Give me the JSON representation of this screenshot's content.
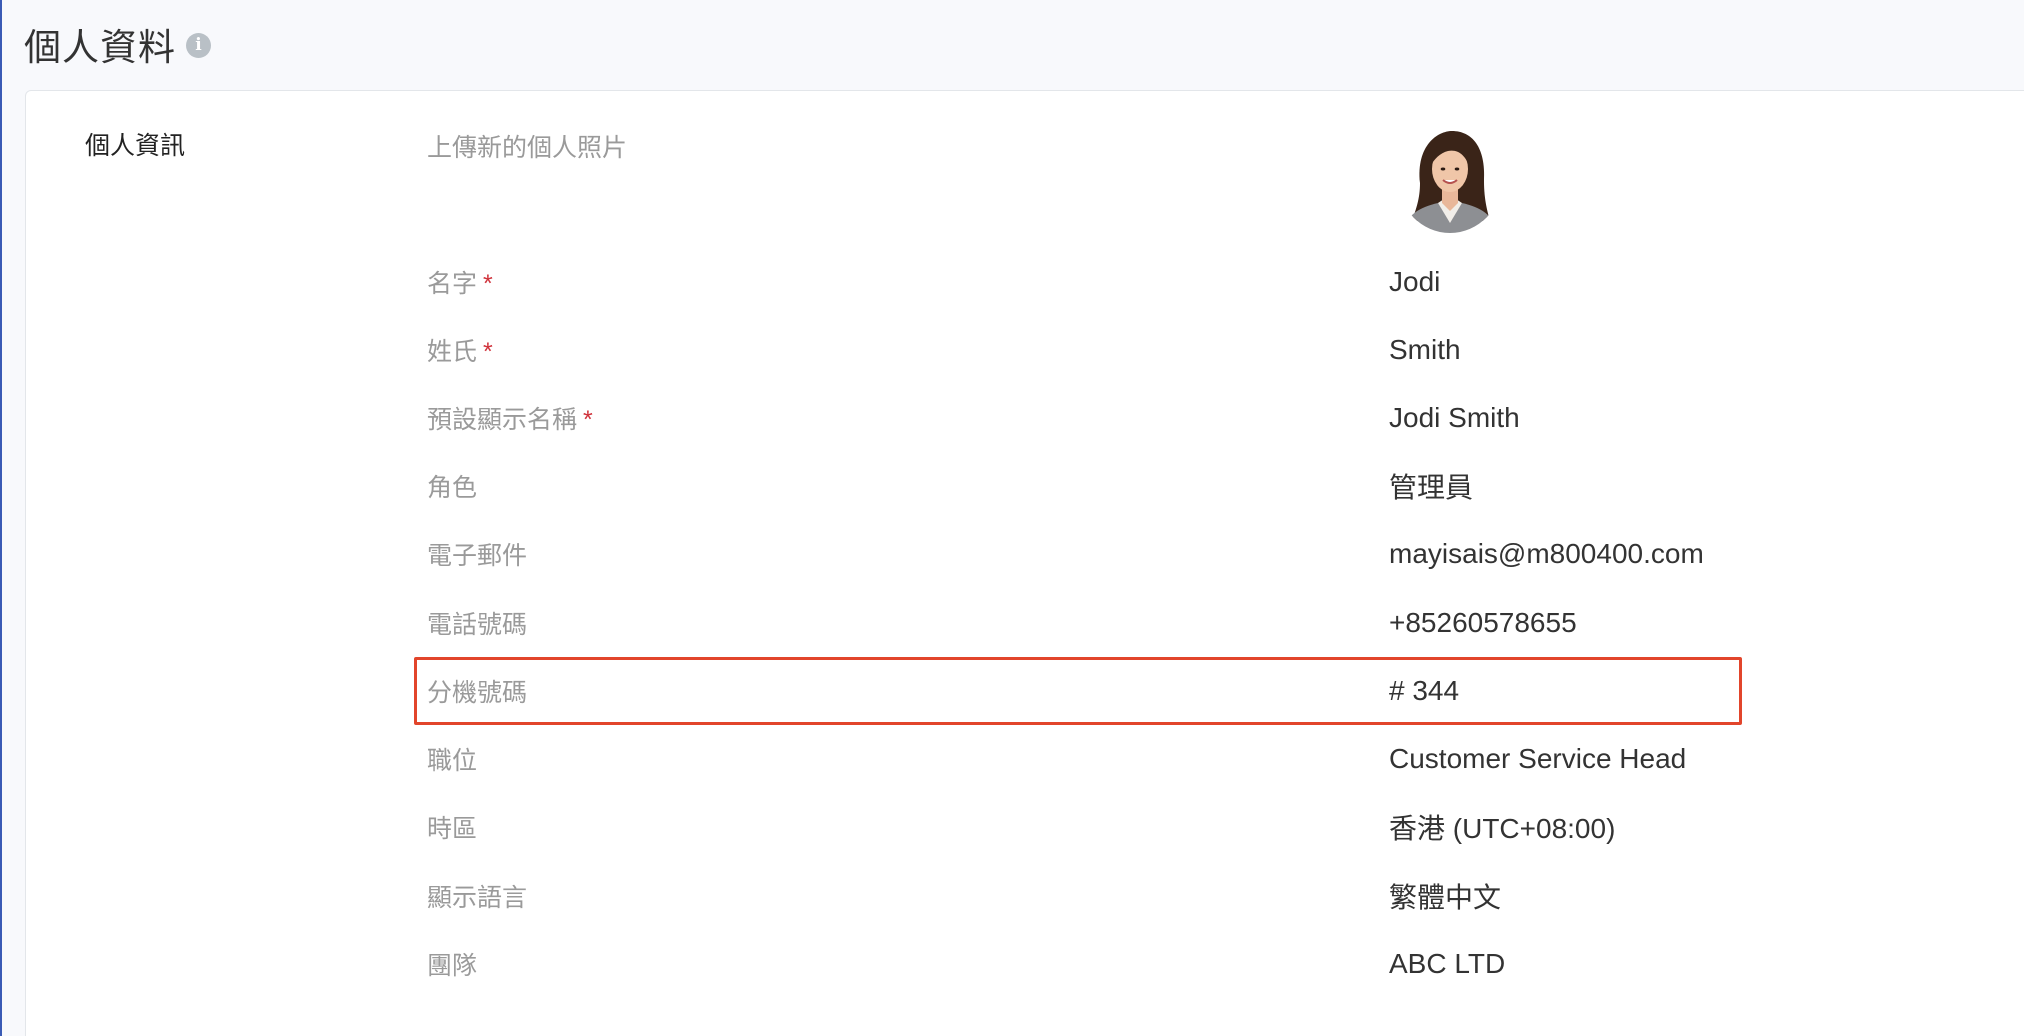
{
  "header": {
    "title": "個人資料",
    "info_icon": "info-icon"
  },
  "profile": {
    "section_label": "個人資訊",
    "upload_label": "上傳新的個人照片",
    "fields": [
      {
        "label": "名字",
        "required": "*",
        "value": "Jodi"
      },
      {
        "label": "姓氏",
        "required": "*",
        "value": "Smith"
      },
      {
        "label": "預設顯示名稱",
        "required": "*",
        "value": "Jodi Smith"
      },
      {
        "label": "角色",
        "required": "",
        "value": "管理員"
      },
      {
        "label": "電子郵件",
        "required": "",
        "value": "mayisais@m800400.com"
      },
      {
        "label": "電話號碼",
        "required": "",
        "value": "+85260578655"
      },
      {
        "label": "分機號碼",
        "required": "",
        "value": "# 344"
      },
      {
        "label": "職位",
        "required": "",
        "value": "Customer Service Head"
      },
      {
        "label": "時區",
        "required": "",
        "value": "香港 (UTC+08:00)"
      },
      {
        "label": "顯示語言",
        "required": "",
        "value": "繁體中文"
      },
      {
        "label": "團隊",
        "required": "",
        "value": "ABC LTD"
      }
    ]
  },
  "colors": {
    "highlight": "#e2452b",
    "required": "#d0323b",
    "accent_border": "#3b5bb5"
  }
}
